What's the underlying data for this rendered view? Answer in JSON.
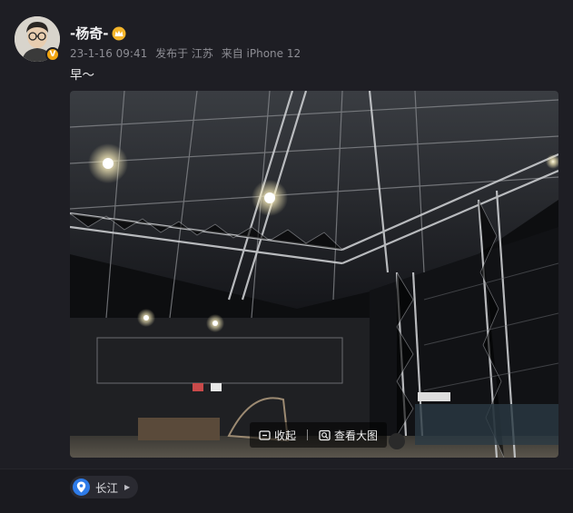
{
  "post": {
    "username": "-杨奇-",
    "verified_badge": "V",
    "timestamp": "23-1-16 09:41",
    "posted_in": "发布于 江苏",
    "device": "来自 iPhone 12",
    "text": "早～"
  },
  "photo_overlay": {
    "collapse_label": "收起",
    "view_large_label": "查看大图"
  },
  "location": {
    "label": "长江"
  },
  "colors": {
    "background": "#1a1a1f",
    "accent_blue": "#2e7be8",
    "badge_orange": "#f2a611"
  },
  "icons": [
    "crown-icon",
    "verified-icon",
    "collapse-icon",
    "zoom-icon",
    "location-pin-icon",
    "arrow-right-icon"
  ]
}
